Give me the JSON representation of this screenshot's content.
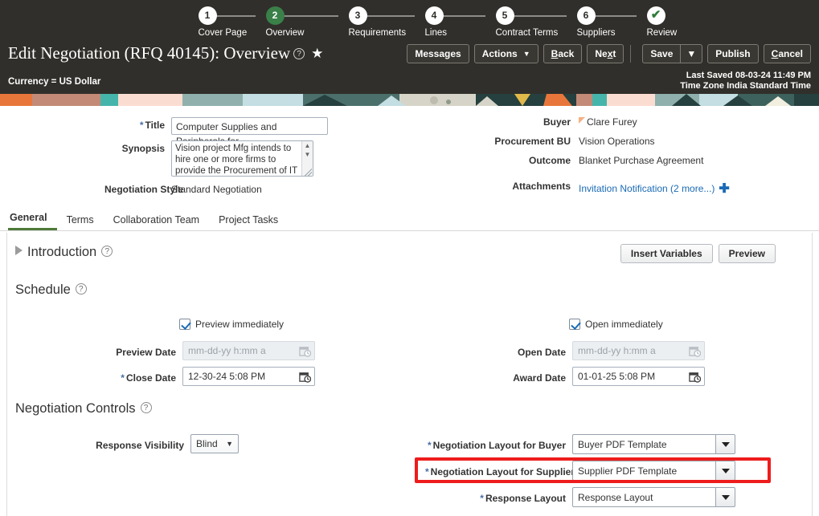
{
  "header": {
    "title": "Edit Negotiation (RFQ 40145): Overview",
    "help_icon": "help-icon",
    "star_icon": "favorite-star-icon",
    "currency": "Currency = US Dollar",
    "last_saved": "Last Saved 08-03-24 11:49 PM",
    "time_zone": "Time Zone India Standard Time",
    "bg_color": "#312f2b",
    "active_color": "#3a8049"
  },
  "train": {
    "steps": [
      {
        "number": "1",
        "label": "Cover Page",
        "state": "pending"
      },
      {
        "number": "2",
        "label": "Overview",
        "state": "active"
      },
      {
        "number": "3",
        "label": "Requirements",
        "state": "pending"
      },
      {
        "number": "4",
        "label": "Lines",
        "state": "pending"
      },
      {
        "number": "5",
        "label": "Contract Terms",
        "state": "pending"
      },
      {
        "number": "6",
        "label": "Suppliers",
        "state": "pending"
      },
      {
        "number": "✔",
        "label": "Review",
        "state": "done"
      }
    ]
  },
  "toolbar": {
    "messages": "Messages",
    "actions": "Actions",
    "back": "Back",
    "next": "Next",
    "save": "Save",
    "publish": "Publish",
    "cancel": "Cancel",
    "caret": "▼"
  },
  "form": {
    "title_label": "Title",
    "title_value": "Computer Supplies and Peripherals for",
    "synopsis_label": "Synopsis",
    "synopsis_value": "Vision project Mfg intends to hire one or more firms to provide the Procurement of IT Supplies",
    "style_label": "Negotiation Style",
    "style_value": "Standard Negotiation",
    "buyer_label": "Buyer",
    "buyer_value": "Clare Furey",
    "bu_label": "Procurement BU",
    "bu_value": "Vision Operations",
    "outcome_label": "Outcome",
    "outcome_value": "Blanket Purchase Agreement",
    "attachments_label": "Attachments",
    "attachments_value": "Invitation Notification (2 more...)",
    "add_attachment_icon": "add-plus-icon"
  },
  "tabs": [
    {
      "label": "General",
      "active": true
    },
    {
      "label": "Terms",
      "active": false
    },
    {
      "label": "Collaboration Team",
      "active": false
    },
    {
      "label": "Project Tasks",
      "active": false
    }
  ],
  "introduction": {
    "heading": "Introduction",
    "insert_variables": "Insert Variables",
    "preview": "Preview",
    "collapsed": true
  },
  "schedule": {
    "heading": "Schedule",
    "preview_immediately": "Preview immediately",
    "preview_immediately_checked": true,
    "open_immediately": "Open immediately",
    "open_immediately_checked": true,
    "preview_date_label": "Preview Date",
    "preview_date_placeholder": "mm-dd-yy h:mm a",
    "preview_date_value": "",
    "close_date_label": "Close Date",
    "close_date_value": "12-30-24 5:08 PM",
    "open_date_label": "Open Date",
    "open_date_placeholder": "mm-dd-yy h:mm a",
    "open_date_value": "",
    "award_date_label": "Award Date",
    "award_date_value": "01-01-25 5:08 PM"
  },
  "controls": {
    "heading": "Negotiation Controls",
    "response_visibility_label": "Response Visibility",
    "response_visibility_value": "Blind",
    "layout_buyer_label": "Negotiation Layout for Buyer",
    "layout_buyer_value": "Buyer PDF Template",
    "layout_supplier_label": "Negotiation Layout for Supplier",
    "layout_supplier_value": "Supplier PDF Template",
    "response_layout_label": "Response Layout",
    "response_layout_value": "Response Layout",
    "highlight_color": "#ee1c1c"
  }
}
